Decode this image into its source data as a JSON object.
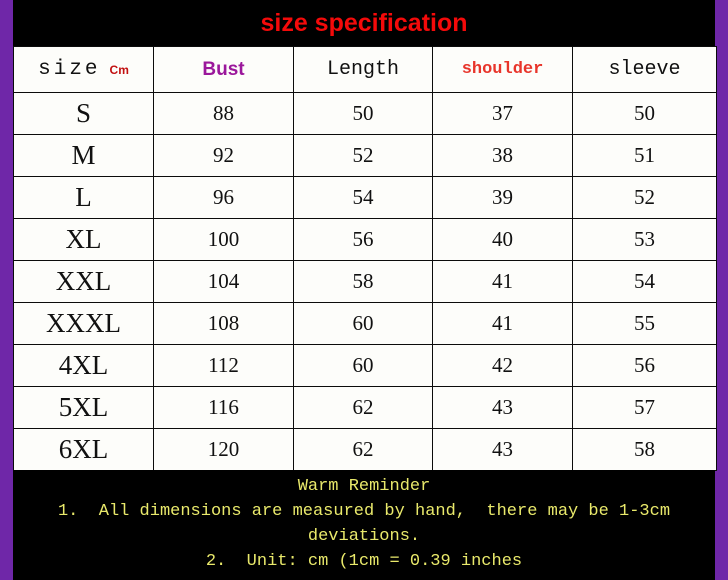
{
  "title": {
    "text": "size specification",
    "color": "#F40A0A",
    "background": "#000000"
  },
  "theme": {
    "accent_purple": "#6F27A8",
    "page_background": "#000000",
    "cell_background": "#FDFDFA",
    "footer_text_color": "#E9E96B"
  },
  "table": {
    "headers": [
      {
        "label": "size",
        "unit": "Cm",
        "color": "#111111",
        "unit_color": "#C21010"
      },
      {
        "label": "Bust",
        "color": "#9B179B"
      },
      {
        "label": "Length",
        "color": "#111111"
      },
      {
        "label": "shoulder",
        "color": "#E8352B"
      },
      {
        "label": "sleeve",
        "color": "#111111"
      }
    ],
    "rows": [
      {
        "size": "S",
        "bust": "88",
        "length": "50",
        "shoulder": "37",
        "sleeve": "50"
      },
      {
        "size": "M",
        "bust": "92",
        "length": "52",
        "shoulder": "38",
        "sleeve": "51"
      },
      {
        "size": "L",
        "bust": "96",
        "length": "54",
        "shoulder": "39",
        "sleeve": "52"
      },
      {
        "size": "XL",
        "bust": "100",
        "length": "56",
        "shoulder": "40",
        "sleeve": "53"
      },
      {
        "size": "XXL",
        "bust": "104",
        "length": "58",
        "shoulder": "41",
        "sleeve": "54"
      },
      {
        "size": "XXXL",
        "bust": "108",
        "length": "60",
        "shoulder": "41",
        "sleeve": "55"
      },
      {
        "size": "4XL",
        "bust": "112",
        "length": "60",
        "shoulder": "42",
        "sleeve": "56"
      },
      {
        "size": "5XL",
        "bust": "116",
        "length": "62",
        "shoulder": "43",
        "sleeve": "57"
      },
      {
        "size": "6XL",
        "bust": "120",
        "length": "62",
        "shoulder": "43",
        "sleeve": "58"
      }
    ]
  },
  "footer": {
    "heading": "Warm Reminder",
    "line1": "1.  All dimensions are measured by hand,  there may be 1-3cm",
    "line2": "deviations.",
    "line3": "2.  Unit: cm (1cm = 0.39 inches"
  }
}
